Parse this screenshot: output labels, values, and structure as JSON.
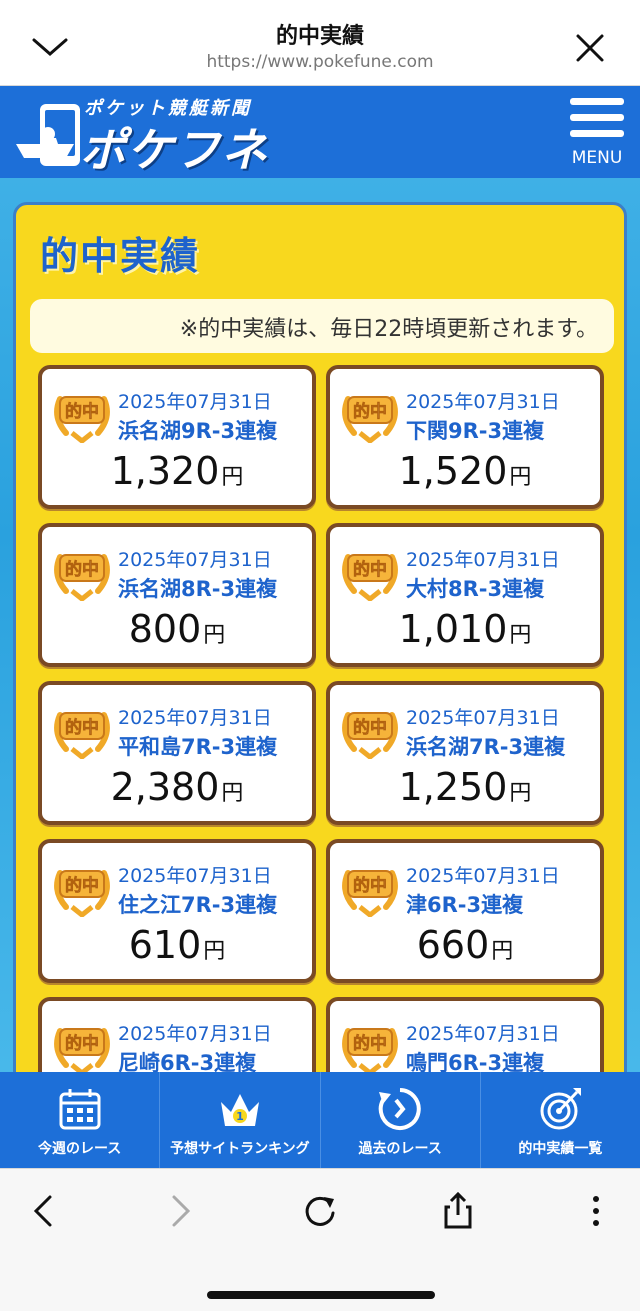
{
  "browser": {
    "title": "的中実績",
    "url": "https://www.pokefune.com"
  },
  "site": {
    "logo_sub": "ポケット競艇新聞",
    "logo_main": "ポケフネ",
    "menu_label": "MENU"
  },
  "panel": {
    "title": "的中実績",
    "notice": "※的中実績は、毎日22時頃更新されます。",
    "badge_text": "的中"
  },
  "cards": [
    {
      "date": "2025年07月31日",
      "race": "浜名湖9R-3連複",
      "amount": "1,320",
      "unit": "円"
    },
    {
      "date": "2025年07月31日",
      "race": "下関9R-3連複",
      "amount": "1,520",
      "unit": "円"
    },
    {
      "date": "2025年07月31日",
      "race": "浜名湖8R-3連複",
      "amount": "800",
      "unit": "円"
    },
    {
      "date": "2025年07月31日",
      "race": "大村8R-3連複",
      "amount": "1,010",
      "unit": "円"
    },
    {
      "date": "2025年07月31日",
      "race": "平和島7R-3連複",
      "amount": "2,380",
      "unit": "円"
    },
    {
      "date": "2025年07月31日",
      "race": "浜名湖7R-3連複",
      "amount": "1,250",
      "unit": "円"
    },
    {
      "date": "2025年07月31日",
      "race": "住之江7R-3連複",
      "amount": "610",
      "unit": "円"
    },
    {
      "date": "2025年07月31日",
      "race": "津6R-3連複",
      "amount": "660",
      "unit": "円"
    },
    {
      "date": "2025年07月31日",
      "race": "尼崎6R-3連複",
      "amount": "",
      "unit": ""
    },
    {
      "date": "2025年07月31日",
      "race": "鳴門6R-3連複",
      "amount": "",
      "unit": ""
    }
  ],
  "bottom_nav": [
    {
      "label": "今週のレース",
      "icon": "calendar-icon"
    },
    {
      "label": "予想サイトランキング",
      "icon": "crown-icon",
      "badge": "1"
    },
    {
      "label": "過去のレース",
      "icon": "history-icon"
    },
    {
      "label": "的中実績一覧",
      "icon": "target-icon"
    }
  ],
  "colors": {
    "brand_blue": "#1d6fd8",
    "panel_yellow": "#f8d81e",
    "text_blue": "#1e63cc",
    "card_border": "#7a4a24"
  }
}
